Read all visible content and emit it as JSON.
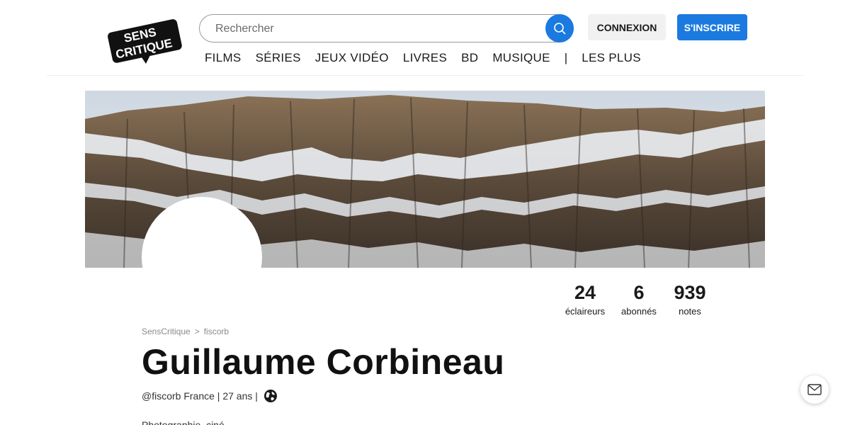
{
  "header": {
    "logo_text_line1": "SENS",
    "logo_text_line2": "CRITIQUE",
    "search_placeholder": "Rechercher",
    "login_label": "CONNEXION",
    "signup_label": "S'INSCRIRE",
    "accent_color": "#1a7ae0",
    "nav": [
      {
        "label": "FILMS"
      },
      {
        "label": "SÉRIES"
      },
      {
        "label": "JEUX VIDÉO"
      },
      {
        "label": "LIVRES"
      },
      {
        "label": "BD"
      },
      {
        "label": "MUSIQUE"
      },
      {
        "label": "|"
      },
      {
        "label": "LES PLUS"
      }
    ]
  },
  "banner": {
    "icon": "mountain-banner-image"
  },
  "stats": [
    {
      "value": "24",
      "label": "éclaireurs"
    },
    {
      "value": "6",
      "label": "abonnés"
    },
    {
      "value": "939",
      "label": "notes"
    }
  ],
  "profile": {
    "breadcrumb": [
      "SensCritique",
      ">",
      "fiscorb"
    ],
    "name": "Guillaume Corbineau",
    "meta": "@fiscorb France | 27 ans |",
    "globe_icon": "globe-icon",
    "bio_peek": "Photographie, ciné..."
  },
  "floating": {
    "mail_icon": "mail-icon"
  }
}
